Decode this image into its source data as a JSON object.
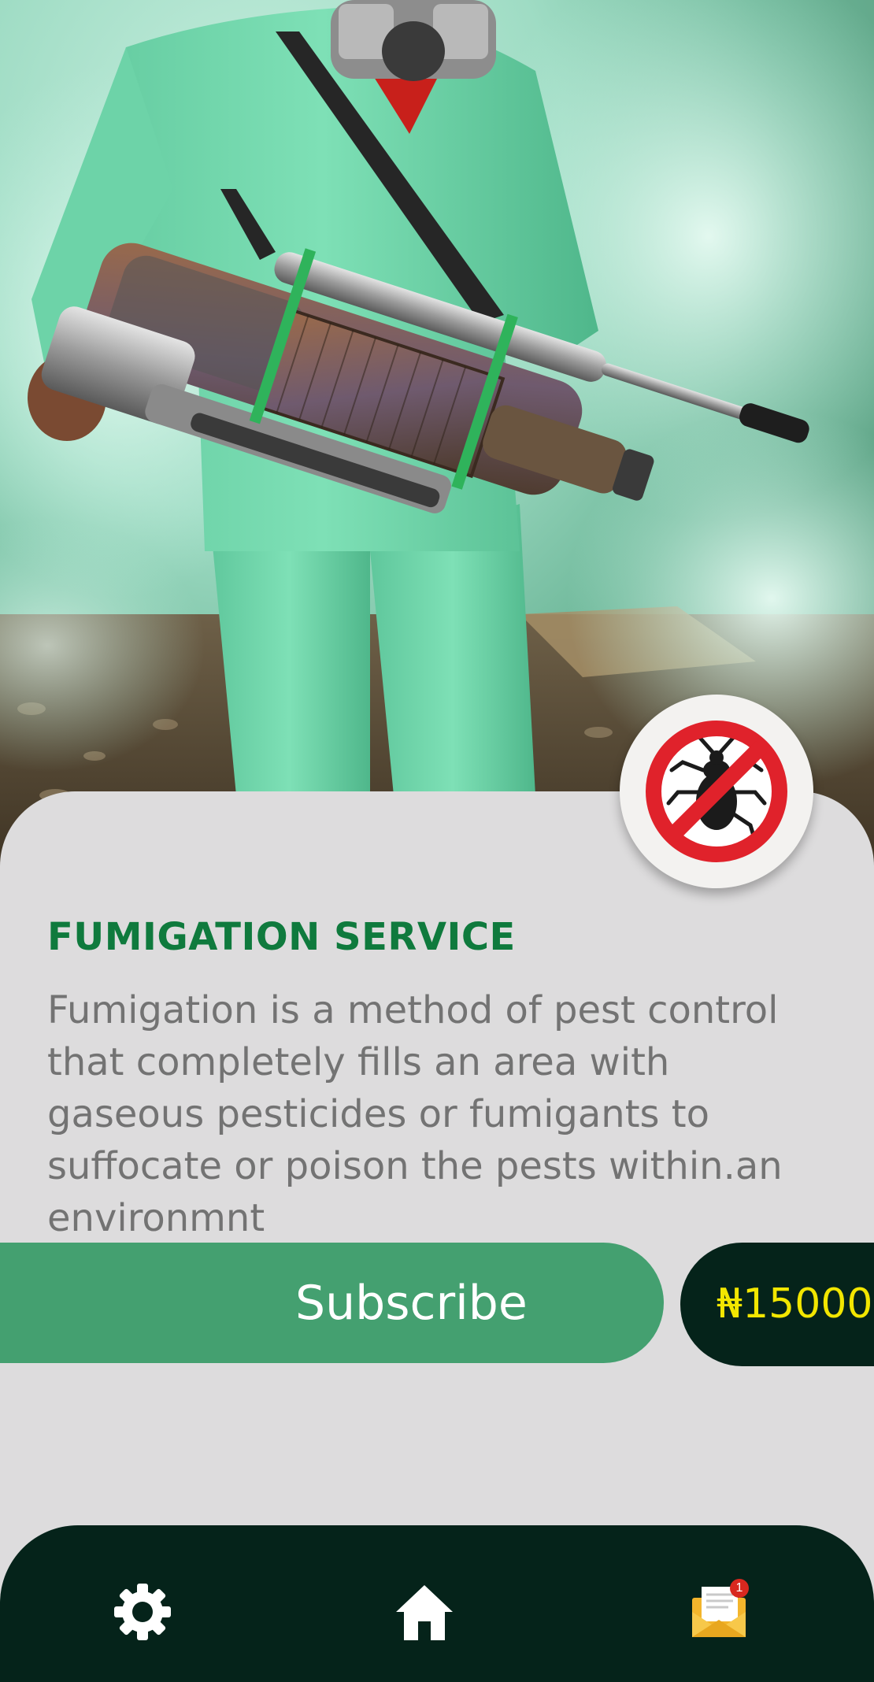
{
  "hero": {
    "image_icon": "fumigation-worker-photo"
  },
  "badge": {
    "icon": "no-pest-icon",
    "colors": {
      "ring": "#e0222b",
      "bug": "#1b1b1b",
      "background": "#f3f2f0"
    }
  },
  "service": {
    "title": "FUMIGATION SERVICE",
    "description": "Fumigation is a method of pest control that completely fills an area with gaseous pesticides or fumigants to suffocate or poison the pests within.an environmnt"
  },
  "actions": {
    "subscribe_label": "Subscribe",
    "price": "₦15000"
  },
  "bottom_nav": {
    "items": [
      {
        "name": "settings",
        "icon": "gear-icon"
      },
      {
        "name": "home",
        "icon": "home-icon"
      },
      {
        "name": "messages",
        "icon": "mail-icon",
        "badge_count": "1"
      }
    ]
  },
  "colors": {
    "title_green": "#0f7a3d",
    "subscribe_green": "#44a070",
    "dark_green": "#05231a",
    "price_yellow": "#f2e600",
    "card_gray": "#dddcdd"
  }
}
